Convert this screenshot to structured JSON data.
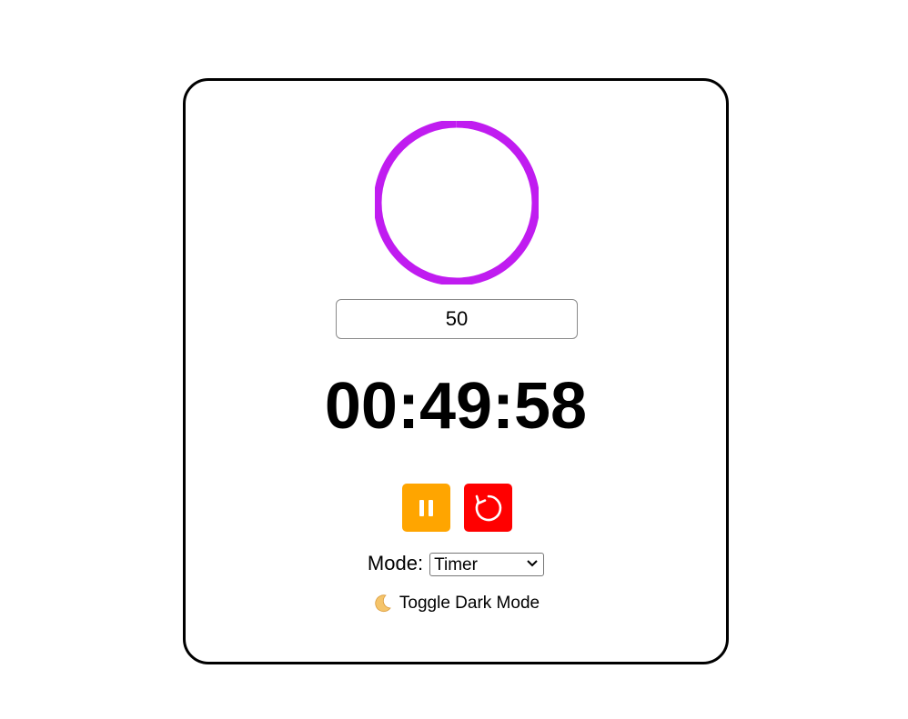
{
  "timer": {
    "minutes_input_value": "50",
    "display": "00:49:58",
    "progress": 0.9993,
    "ring_color": "#c01cf0"
  },
  "controls": {
    "pause_icon": "pause-icon",
    "pause_color": "#ffa500",
    "reset_icon": "reset-icon",
    "reset_color": "#ff0000"
  },
  "mode": {
    "label": "Mode:",
    "selected": "Timer"
  },
  "dark_mode": {
    "icon": "crescent-moon-icon",
    "label": "Toggle Dark Mode"
  }
}
